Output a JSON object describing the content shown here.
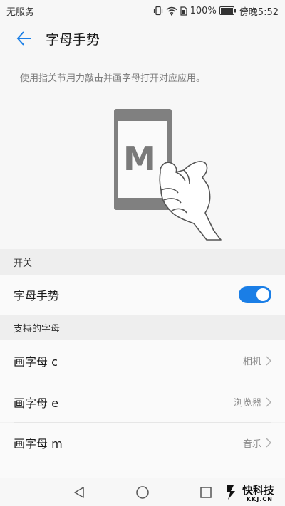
{
  "status_bar": {
    "carrier": "无服务",
    "battery_percent": "100%",
    "time": "傍晚5:52"
  },
  "header": {
    "title": "字母手势"
  },
  "intro": {
    "description": "使用指关节用力敲击并画字母打开对应应用。",
    "illustration_letter": "M"
  },
  "sections": {
    "switch_header": "开关",
    "letters_header": "支持的字母"
  },
  "toggle_row": {
    "label": "字母手势",
    "enabled": true
  },
  "letters": [
    {
      "label": "画字母 c",
      "app": "相机"
    },
    {
      "label": "画字母 e",
      "app": "浏览器"
    },
    {
      "label": "画字母 m",
      "app": "音乐"
    }
  ],
  "watermark": {
    "text": "快科技",
    "sub": "KKJ.CN"
  },
  "colors": {
    "accent": "#1a7ee6",
    "toggle_on": "#1a7ee6"
  },
  "icons": {
    "back": "arrow-left-icon",
    "vibrate": "vibrate-icon",
    "wifi": "wifi-icon",
    "sim": "sim-icon",
    "battery": "battery-icon",
    "chevron": "chevron-right-icon",
    "nav_back": "triangle-back-icon",
    "nav_home": "circle-home-icon",
    "nav_recent": "square-recent-icon"
  }
}
